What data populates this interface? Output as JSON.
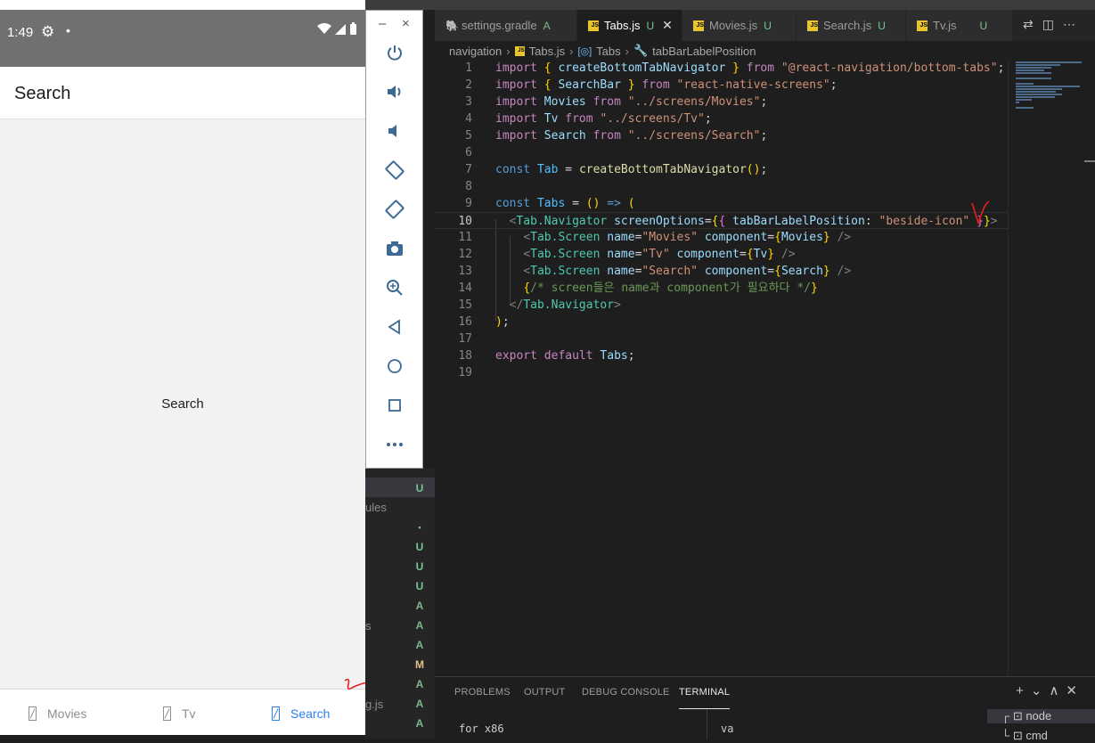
{
  "phone": {
    "status_time": "1:49",
    "header_title": "Search",
    "content_text": "Search",
    "tabs": [
      {
        "label": "Movies",
        "active": false
      },
      {
        "label": "Tv",
        "active": false
      },
      {
        "label": "Search",
        "active": true
      }
    ],
    "active_tab_color": "#2f80ed"
  },
  "emulator_toolbar": {
    "minimize": "–",
    "close": "×",
    "buttons": [
      "power-icon",
      "volume-up-icon",
      "volume-down-icon",
      "rotate-left-icon",
      "rotate-right-icon",
      "camera-icon",
      "zoom-icon",
      "back-icon",
      "home-icon",
      "overview-icon",
      "more-icon"
    ]
  },
  "explorer": {
    "fragments": [
      "ules",
      "s",
      "g.js"
    ],
    "badges": [
      "U",
      "•",
      "U",
      "U",
      "U",
      "A",
      "A",
      "A",
      "M",
      "A",
      "A",
      "A"
    ]
  },
  "editor_tabs": [
    {
      "name": "settings.gradle",
      "status": "A",
      "active": false
    },
    {
      "name": "Tabs.js",
      "status": "U",
      "active": true
    },
    {
      "name": "Movies.js",
      "status": "U",
      "active": false
    },
    {
      "name": "Search.js",
      "status": "U",
      "active": false
    },
    {
      "name": "Tv.js",
      "status": "U",
      "active": false
    }
  ],
  "breadcrumb": [
    "navigation",
    "Tabs.js",
    "Tabs",
    "tabBarLabelPosition"
  ],
  "code": {
    "current_line": 10,
    "lines": [
      "import { createBottomTabNavigator } from \"@react-navigation/bottom-tabs\";",
      "import { SearchBar } from \"react-native-screens\";",
      "import Movies from \"../screens/Movies\";",
      "import Tv from \"../screens/Tv\";",
      "import Search from \"../screens/Search\";",
      "",
      "const Tab = createBottomTabNavigator();",
      "",
      "const Tabs = () => (",
      "  <Tab.Navigator screenOptions={{ tabBarLabelPosition: \"beside-icon\" }}>",
      "    <Tab.Screen name=\"Movies\" component={Movies} />",
      "    <Tab.Screen name=\"Tv\" component={Tv} />",
      "    <Tab.Screen name=\"Search\" component={Search} />",
      "    {/* screen들은 name과 component가 필요하다 */}",
      "  </Tab.Navigator>",
      ");",
      "",
      "export default Tabs;",
      ""
    ]
  },
  "panel": {
    "tabs": [
      "PROBLEMS",
      "OUTPUT",
      "DEBUG CONSOLE",
      "TERMINAL"
    ],
    "active_tab": "TERMINAL",
    "terminal_left": "for x86",
    "terminal_right": "va",
    "terminals": [
      "node",
      "cmd"
    ]
  }
}
